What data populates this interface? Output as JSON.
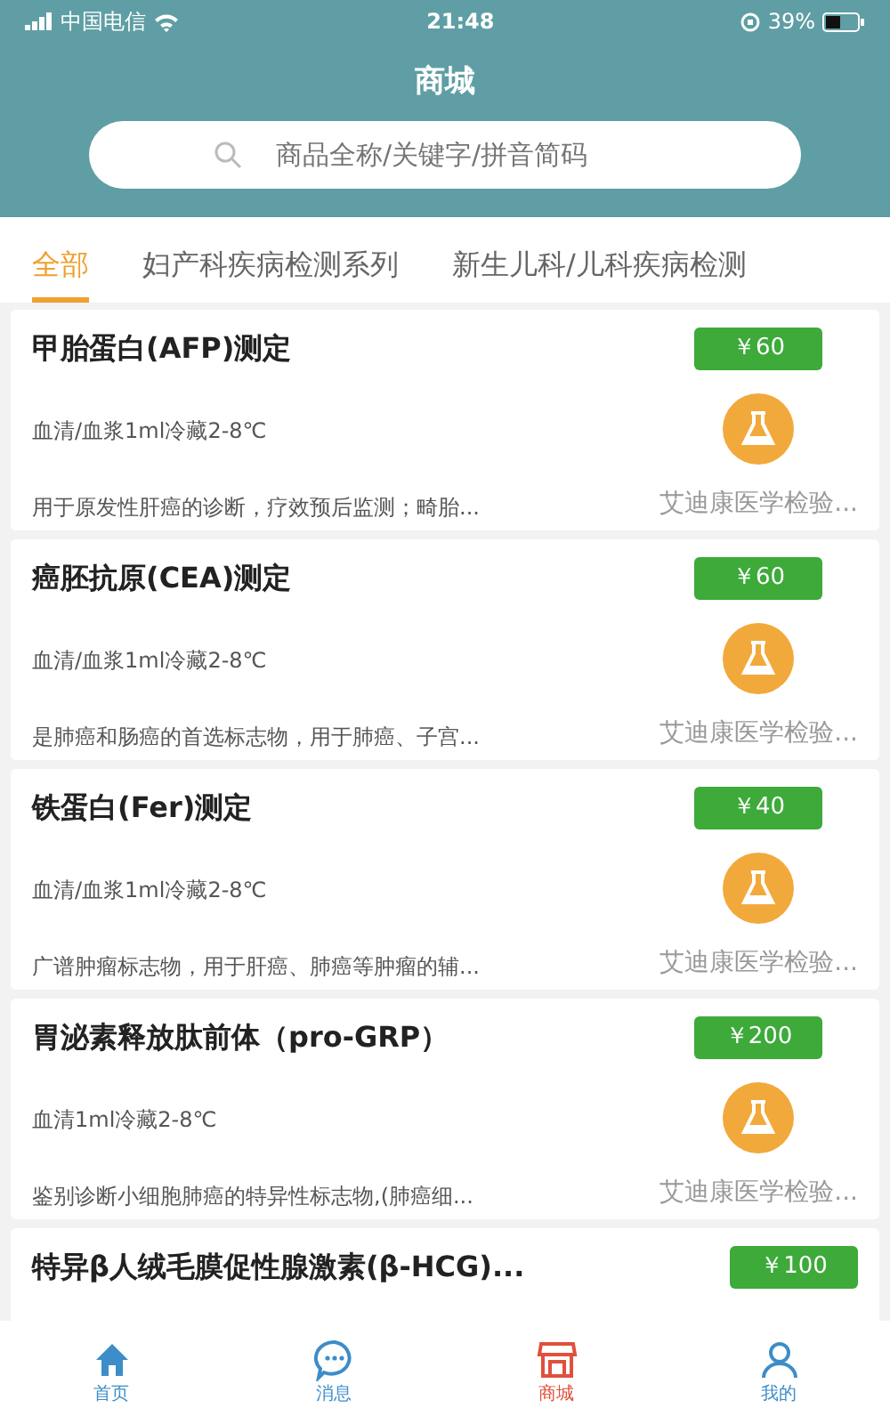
{
  "status_bar": {
    "carrier": "中国电信",
    "time": "21:48",
    "battery": "39%"
  },
  "header": {
    "title": "商城",
    "search": {
      "placeholder": "商品全称/关键字/拼音简码"
    }
  },
  "tabs": [
    {
      "label": "全部",
      "selected": true
    },
    {
      "label": "妇产科疾病检测系列",
      "selected": false
    },
    {
      "label": "新生儿科/儿科疾病检测",
      "selected": false
    }
  ],
  "products": [
    {
      "title": "甲胎蛋白(AFP)测定",
      "price": "￥60",
      "spec": "血清/血浆1ml冷藏2-8℃",
      "description": "用于原发性肝癌的诊断，疗效预后监测；畸胎...",
      "vendor": "艾迪康医学检验..."
    },
    {
      "title": "癌胚抗原(CEA)测定",
      "price": "￥60",
      "spec": "血清/血浆1ml冷藏2-8℃",
      "description": "是肺癌和肠癌的首选标志物，用于肺癌、子宫...",
      "vendor": "艾迪康医学检验..."
    },
    {
      "title": "铁蛋白(Fer)测定",
      "price": "￥40",
      "spec": "血清/血浆1ml冷藏2-8℃",
      "description": "广谱肿瘤标志物，用于肝癌、肺癌等肿瘤的辅...",
      "vendor": "艾迪康医学检验..."
    },
    {
      "title": "胃泌素释放肽前体（pro-GRP）",
      "price": "￥200",
      "spec": "血清1ml冷藏2-8℃",
      "description": "鉴别诊断小细胞肺癌的特异性标志物,(肺癌细...",
      "vendor": "艾迪康医学检验..."
    },
    {
      "title": "特异β人绒毛膜促性腺激素(β-HCG)...",
      "price": "￥100"
    }
  ],
  "bottom_nav": [
    {
      "kind": "home",
      "label": "首页",
      "selected": false
    },
    {
      "kind": "message",
      "label": "消息",
      "selected": false
    },
    {
      "kind": "store",
      "label": "商城",
      "selected": true
    },
    {
      "kind": "profile",
      "label": "我的",
      "selected": false
    }
  ]
}
